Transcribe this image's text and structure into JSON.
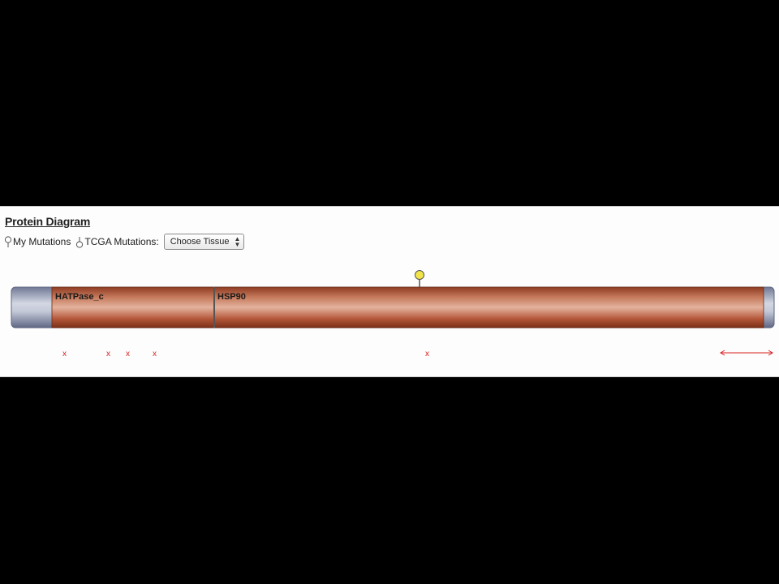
{
  "panel": {
    "title": "Protein Diagram",
    "legend": {
      "my_mutations_label": "My Mutations",
      "tcga_mutations_label": "TCGA Mutations:"
    },
    "tissue_select": {
      "selected": "Choose Tissue",
      "options": [
        "Choose Tissue"
      ]
    }
  },
  "protein": {
    "domains": [
      {
        "name": "HATPase_c",
        "color": "#b4573c"
      },
      {
        "name": "HSP90",
        "color": "#b4573c"
      }
    ],
    "terminus_color": "#8f97b0",
    "my_mutation_marker_color": "#f2e34a",
    "tcga_marker_symbol": "x",
    "tcga_marker_color": "#d92020",
    "tcga_marker_count": 5,
    "scale_arrow_color": "#d92020"
  }
}
